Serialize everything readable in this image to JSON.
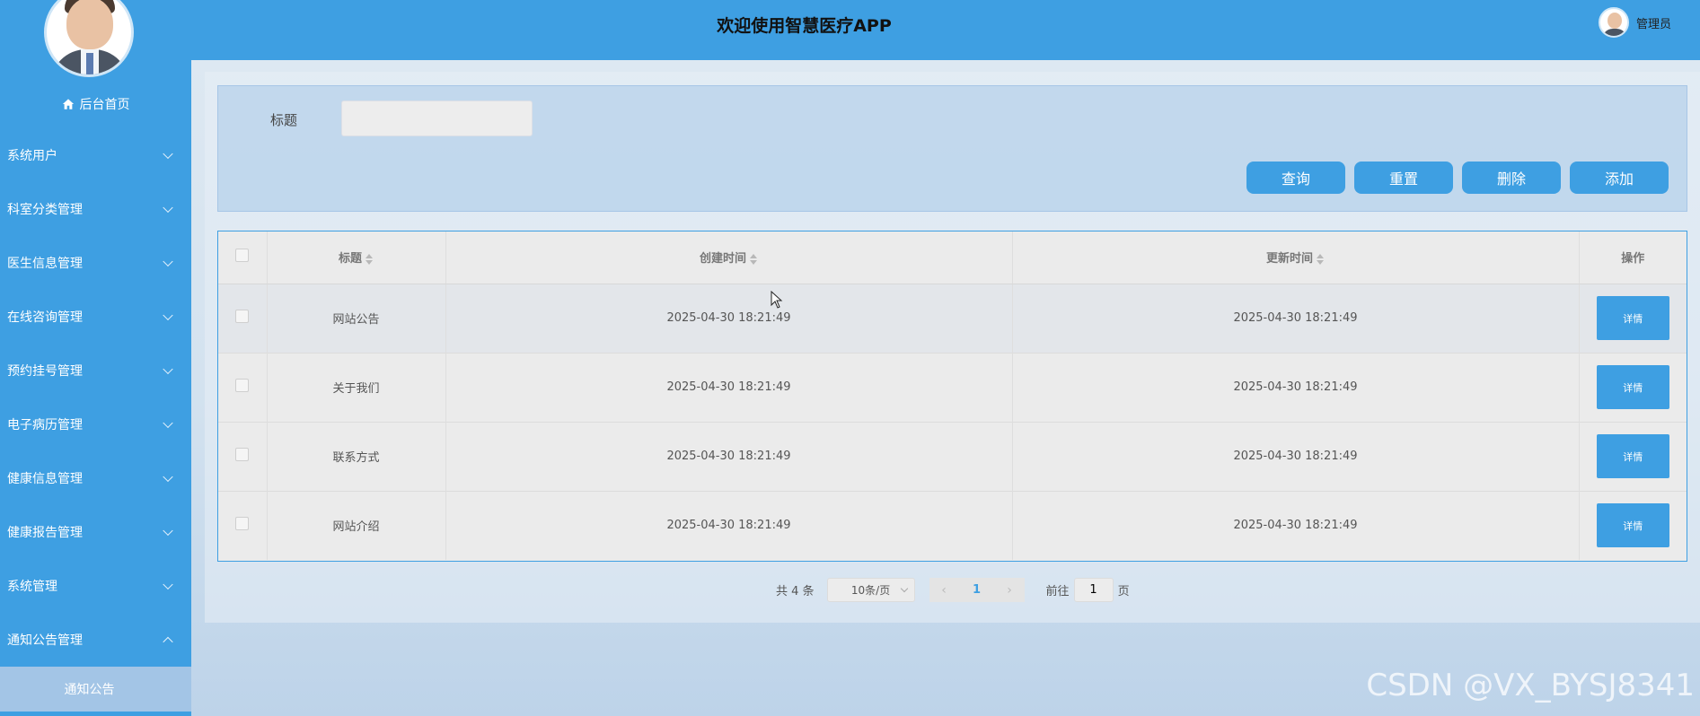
{
  "header": {
    "title": "欢迎使用智慧医疗APP",
    "username": "管理员"
  },
  "sidebar": {
    "home_label": "后台首页",
    "items": [
      {
        "label": "系统用户",
        "expanded": false
      },
      {
        "label": "科室分类管理",
        "expanded": false
      },
      {
        "label": "医生信息管理",
        "expanded": false
      },
      {
        "label": "在线咨询管理",
        "expanded": false
      },
      {
        "label": "预约挂号管理",
        "expanded": false
      },
      {
        "label": "电子病历管理",
        "expanded": false
      },
      {
        "label": "健康信息管理",
        "expanded": false
      },
      {
        "label": "健康报告管理",
        "expanded": false
      },
      {
        "label": "系统管理",
        "expanded": false
      },
      {
        "label": "通知公告管理",
        "expanded": true
      }
    ],
    "submenu": {
      "label": "通知公告"
    }
  },
  "search": {
    "label": "标题",
    "value": "",
    "buttons": {
      "query": "查询",
      "reset": "重置",
      "delete": "删除",
      "add": "添加"
    }
  },
  "table": {
    "columns": {
      "title": "标题",
      "created": "创建时间",
      "updated": "更新时间",
      "action": "操作"
    },
    "rows": [
      {
        "title": "网站公告",
        "created": "2025-04-30 18:21:49",
        "updated": "2025-04-30 18:21:49",
        "action": "详情"
      },
      {
        "title": "关于我们",
        "created": "2025-04-30 18:21:49",
        "updated": "2025-04-30 18:21:49",
        "action": "详情"
      },
      {
        "title": "联系方式",
        "created": "2025-04-30 18:21:49",
        "updated": "2025-04-30 18:21:49",
        "action": "详情"
      },
      {
        "title": "网站介绍",
        "created": "2025-04-30 18:21:49",
        "updated": "2025-04-30 18:21:49",
        "action": "详情"
      }
    ]
  },
  "pagination": {
    "total": "共 4 条",
    "page_size": "10条/页",
    "current_page": "1",
    "goto_prefix": "前往",
    "goto_value": "1",
    "goto_suffix": "页"
  },
  "watermark": "CSDN @VX_BYSJ8341",
  "colors": {
    "primary": "#3e9fe2",
    "submenu_active": "#a3c5e6"
  }
}
